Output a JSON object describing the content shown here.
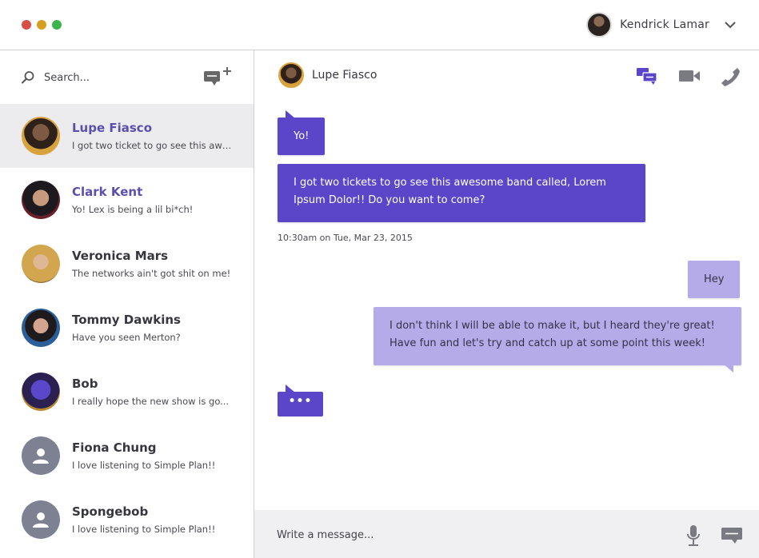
{
  "window": {
    "traffic_lights": {
      "close": "#d94d45",
      "minimize": "#d4a020",
      "maximize": "#3bb54a"
    }
  },
  "current_user": {
    "name": "Kendrick Lamar",
    "avatar_icon": "user-avatar-photo",
    "menu_icon": "chevron-down-icon"
  },
  "sidebar": {
    "search_placeholder": "Search...",
    "new_chat_icon": "new-message-plus-icon",
    "contacts": [
      {
        "name": "Lupe Fiasco",
        "preview": "I got two ticket to go see this awe...",
        "active": true,
        "highlight": true
      },
      {
        "name": "Clark Kent",
        "preview": "Yo! Lex is being a lil bi*ch!",
        "active": false,
        "highlight": true
      },
      {
        "name": "Veronica Mars",
        "preview": "The networks ain't got shit on me!",
        "active": false,
        "highlight": false
      },
      {
        "name": "Tommy Dawkins",
        "preview": "Have you seen Merton?",
        "active": false,
        "highlight": false
      },
      {
        "name": "Bob",
        "preview": "I really hope the new show is go...",
        "active": false,
        "highlight": false
      },
      {
        "name": "Fiona Chung",
        "preview": "I love listening to Simple Plan!!",
        "active": false,
        "highlight": false
      },
      {
        "name": "Spongebob",
        "preview": "I love listening to Simple Plan!!",
        "active": false,
        "highlight": false
      }
    ]
  },
  "chat": {
    "contact_name": "Lupe Fiasco",
    "header_icons": [
      "chat-bubbles-icon",
      "video-camera-icon",
      "phone-icon"
    ],
    "messages": [
      {
        "direction": "incoming",
        "text": "Yo!"
      },
      {
        "direction": "incoming",
        "line1": "I got two tickets to go see this awesome band called, Lorem",
        "line2": "Ipsum Dolor!! Do you want to come?"
      },
      {
        "direction": "outgoing",
        "text": "Hey"
      },
      {
        "direction": "outgoing",
        "line1": "I don't think I will be able to make it, but I heard they're great!",
        "line2": "Have fun and let's try and catch up at some point this week!"
      }
    ],
    "timestamp": "10:30am on Tue, Mar 23, 2015",
    "typing_indicator": "•••",
    "composer_placeholder": "Write a message...",
    "composer_icons": [
      "microphone-icon",
      "send-message-icon"
    ]
  },
  "colors": {
    "accent": "#5b45c8",
    "outgoing_bubble": "#b4abe8",
    "highlight_name": "#5b4fae"
  }
}
